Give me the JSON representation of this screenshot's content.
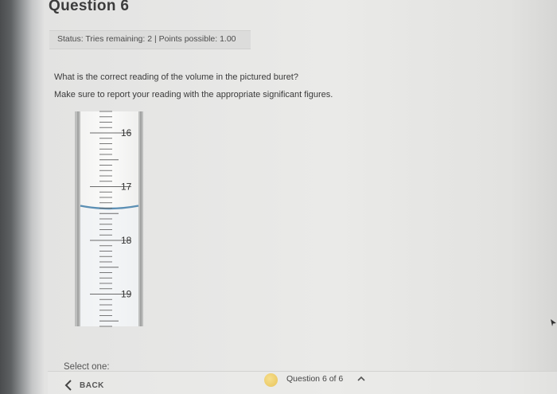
{
  "question": {
    "title": "Question 6",
    "status": "Status: Tries remaining: 2 | Points possible: 1.00",
    "prompt_line1": "What is the correct reading of the volume in the pictured buret?",
    "prompt_line2": "Make sure to report your reading with the appropriate significant figures."
  },
  "buret": {
    "scale_labels": [
      "16",
      "17",
      "18",
      "19"
    ],
    "visible_range_ml": [
      15.6,
      19.6
    ],
    "meniscus_reading_ml": 17.4,
    "liquid_color": "#5b8fb4"
  },
  "answer": {
    "select_label": "Select one:"
  },
  "footer": {
    "back_label": "BACK",
    "question_nav": "Question 6 of 6",
    "status_dot_color": "#e9c35a",
    "back_icon": "chevron-left-icon",
    "nav_icon": "chevron-up-icon"
  }
}
